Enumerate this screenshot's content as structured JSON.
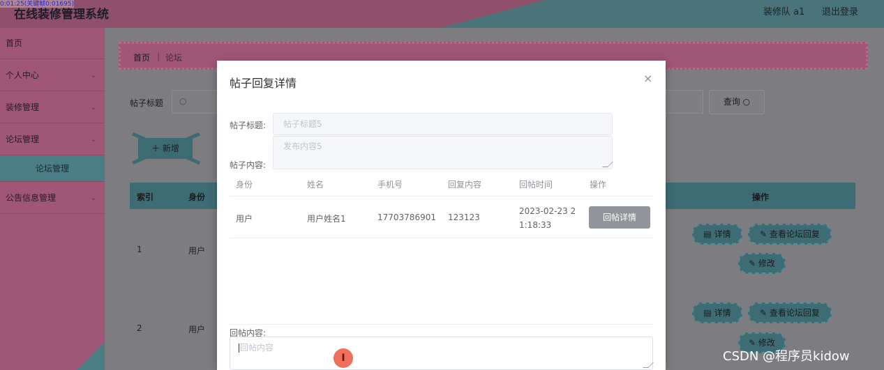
{
  "header": {
    "app_title": "在线装修管理系统",
    "rec_stamp": "0:01:25(关键帧0:01695)",
    "user": "装修队 a1",
    "logout": "退出登录"
  },
  "sidebar": {
    "items": [
      {
        "label": "首页",
        "has_chevron": false
      },
      {
        "label": "个人中心",
        "has_chevron": true
      },
      {
        "label": "装修管理",
        "has_chevron": true
      },
      {
        "label": "论坛管理",
        "has_chevron": true
      },
      {
        "label": "论坛管理",
        "sub": true
      },
      {
        "label": "公告信息管理",
        "has_chevron": true
      }
    ],
    "chevron": "⌄"
  },
  "breadcrumb": {
    "home": "首页",
    "separator": "|",
    "current": "论坛"
  },
  "search": {
    "label": "帖子标题",
    "icon": "search-icon",
    "query_button": "查询 ○"
  },
  "toolbar": {
    "add_button": "＋ 新增"
  },
  "table": {
    "columns": {
      "index": "索引",
      "identity": "身份",
      "actions": "操作"
    },
    "rows": [
      {
        "index": "1",
        "identity": "用户"
      },
      {
        "index": "2",
        "identity": "用户"
      }
    ],
    "action_labels": {
      "detail": "▤ 详情",
      "view_replies": "✎ 查看论坛回复",
      "edit": "✎ 修改"
    }
  },
  "modal": {
    "title": "帖子回复详情",
    "close": "×",
    "post_title_label": "帖子标题:",
    "post_title_value": "帖子标题5",
    "post_content_label": "帖子内容:",
    "post_content_value": "发布内容5",
    "replies": {
      "columns": [
        "身份",
        "姓名",
        "手机号",
        "回复内容",
        "回帖时间",
        "操作"
      ],
      "rows": [
        {
          "identity": "用户",
          "name": "用户姓名1",
          "phone": "17703786901",
          "content": "123123",
          "time": "2023-02-23 21:18:33",
          "time_line1": "2023-02-23 2",
          "time_line2": "1:18:33",
          "action": "回帖详情"
        }
      ]
    },
    "reply_label": "回帖内容:",
    "reply_placeholder": "回帖内容"
  },
  "cursor_badge": "I",
  "watermark": "CSDN @程序员kidow"
}
